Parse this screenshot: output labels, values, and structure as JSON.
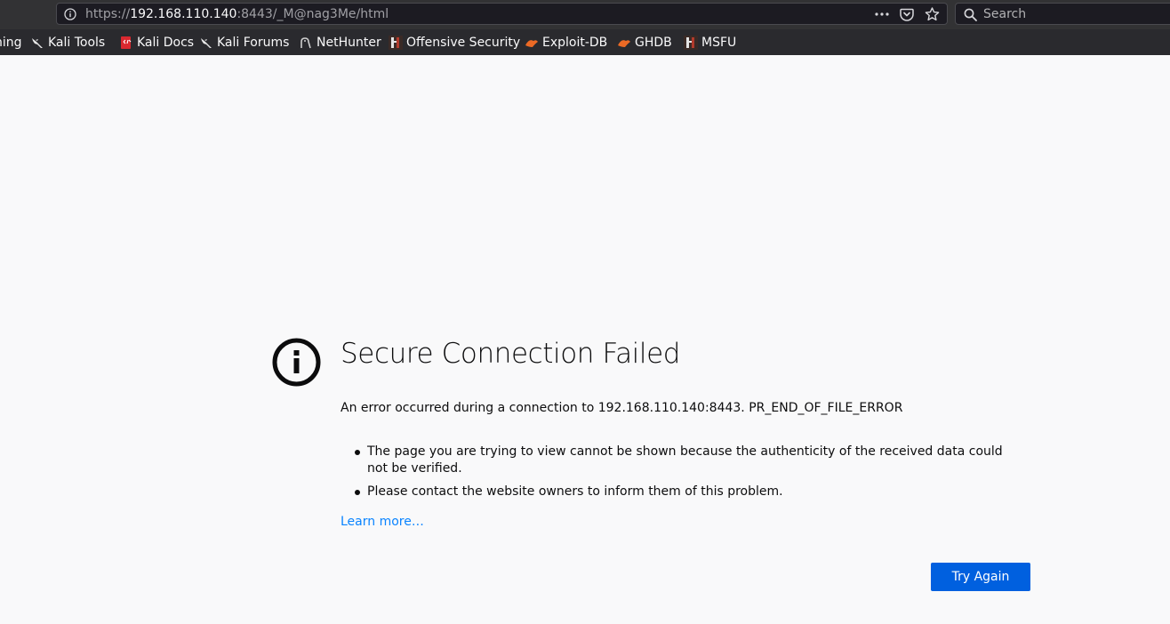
{
  "browser": {
    "url": {
      "scheme": "https://",
      "host": "192.168.110.140",
      "rest": ":8443/_M@nag3Me/html"
    },
    "search_placeholder": "Search",
    "bookmarks": [
      {
        "label": "hing",
        "icon": "bookmark-fragment-icon"
      },
      {
        "label": "Kali Tools",
        "icon": "kali-dragon-icon"
      },
      {
        "label": "Kali Docs",
        "icon": "kali-docs-icon"
      },
      {
        "label": "Kali Forums",
        "icon": "kali-dragon-icon"
      },
      {
        "label": "NetHunter",
        "icon": "nethunter-icon"
      },
      {
        "label": "Offensive Security",
        "icon": "offsec-icon"
      },
      {
        "label": "Exploit-DB",
        "icon": "exploit-db-icon"
      },
      {
        "label": "GHDB",
        "icon": "exploit-db-icon"
      },
      {
        "label": "MSFU",
        "icon": "offsec-icon"
      }
    ]
  },
  "error": {
    "title": "Secure Connection Failed",
    "description": "An error occurred during a connection to 192.168.110.140:8443. PR_END_OF_FILE_ERROR",
    "bullets": [
      "The page you are trying to view cannot be shown because the authenticity of the received data could not be verified.",
      "Please contact the website owners to inform them of this problem."
    ],
    "learn_more": "Learn more…",
    "try_again": "Try Again"
  },
  "colors": {
    "page_bg": "#f9f9fa",
    "toolbar_bg": "#323234",
    "link": "#0a84ff",
    "button": "#0060df"
  }
}
